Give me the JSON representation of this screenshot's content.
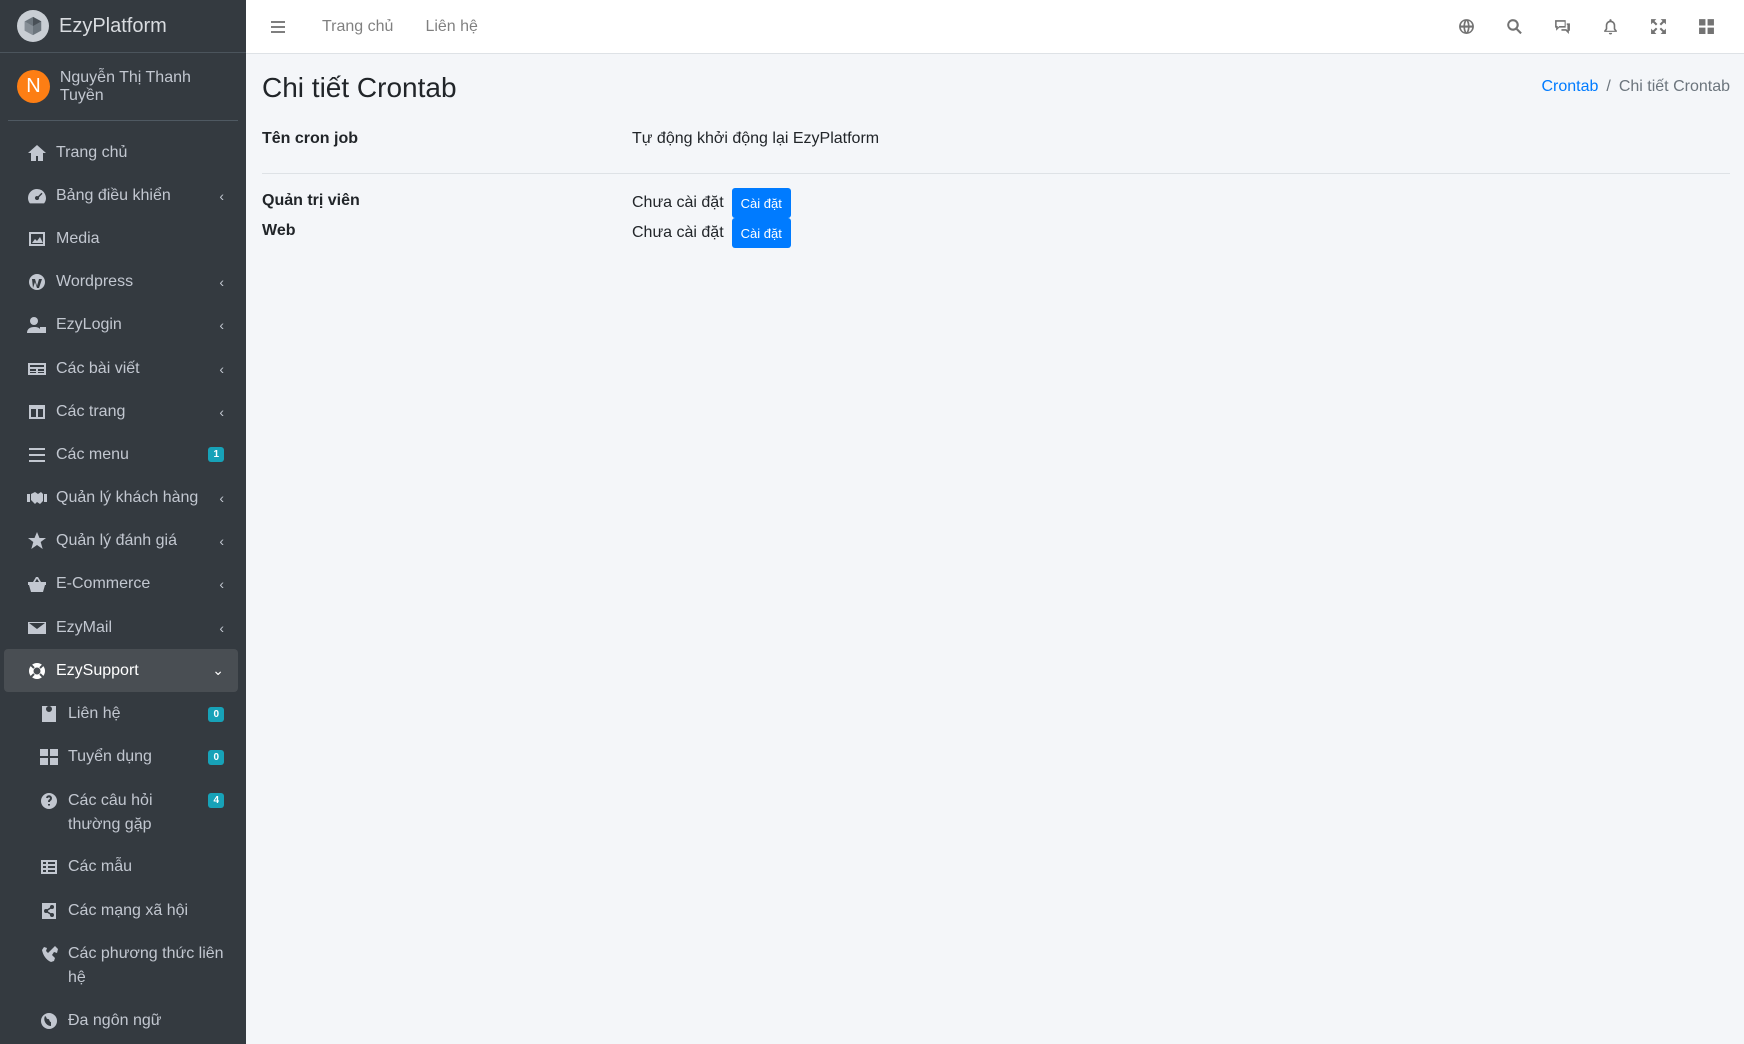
{
  "brand": {
    "name": "EzyPlatform"
  },
  "user": {
    "initial": "N",
    "name": "Nguyễn Thị Thanh Tuyền"
  },
  "sidebar": {
    "items": [
      {
        "label": "Trang chủ",
        "icon": "home-icon"
      },
      {
        "label": "Bảng điều khiển",
        "icon": "dashboard-icon",
        "expandable": true
      },
      {
        "label": "Media",
        "icon": "image-icon"
      },
      {
        "label": "Wordpress",
        "icon": "wordpress-icon",
        "expandable": true
      },
      {
        "label": "EzyLogin",
        "icon": "user-lock-icon",
        "expandable": true
      },
      {
        "label": "Các bài viết",
        "icon": "newspaper-icon",
        "expandable": true
      },
      {
        "label": "Các trang",
        "icon": "columns-icon",
        "expandable": true
      },
      {
        "label": "Các menu",
        "icon": "bars-icon",
        "badge": "1"
      },
      {
        "label": "Quản lý khách hàng",
        "icon": "handshake-icon",
        "expandable": true
      },
      {
        "label": "Quản lý đánh giá",
        "icon": "star-icon",
        "expandable": true
      },
      {
        "label": "E-Commerce",
        "icon": "basket-icon",
        "expandable": true
      },
      {
        "label": "EzyMail",
        "icon": "envelope-icon",
        "expandable": true
      },
      {
        "label": "EzySupport",
        "icon": "life-ring-icon",
        "expanded": true
      }
    ],
    "sub_items": [
      {
        "label": "Liên hệ",
        "icon": "contact-icon",
        "badge": "0"
      },
      {
        "label": "Tuyển dụng",
        "icon": "grid-icon",
        "badge": "0"
      },
      {
        "label": "Các câu hỏi thường gặp",
        "icon": "question-icon",
        "badge": "4"
      },
      {
        "label": "Các mẫu",
        "icon": "table-icon"
      },
      {
        "label": "Các mạng xã hội",
        "icon": "share-icon"
      },
      {
        "label": "Các phương thức liên hệ",
        "icon": "phone-icon"
      },
      {
        "label": "Đa ngôn ngữ",
        "icon": "globe-icon"
      }
    ]
  },
  "topbar": {
    "links": [
      "Trang chủ",
      "Liên hệ"
    ],
    "icons": [
      "language-icon",
      "search-icon",
      "comments-icon",
      "bell-icon",
      "fullscreen-icon",
      "apps-icon"
    ]
  },
  "page": {
    "title": "Chi tiết Crontab",
    "breadcrumb": {
      "parent": "Crontab",
      "separator": "/",
      "current": "Chi tiết Crontab"
    }
  },
  "detail": {
    "name_label": "Tên cron job",
    "name_value": "Tự động khởi động lại EzyPlatform",
    "admin_label": "Quản trị viên",
    "admin_status": "Chưa cài đặt",
    "admin_button": "Cài đặt",
    "web_label": "Web",
    "web_status": "Chưa cài đặt",
    "web_button": "Cài đặt"
  },
  "colors": {
    "sidebar_bg": "#343a40",
    "accent": "#007bff",
    "badge": "#17a2b8",
    "avatar": "#fd7e14"
  }
}
